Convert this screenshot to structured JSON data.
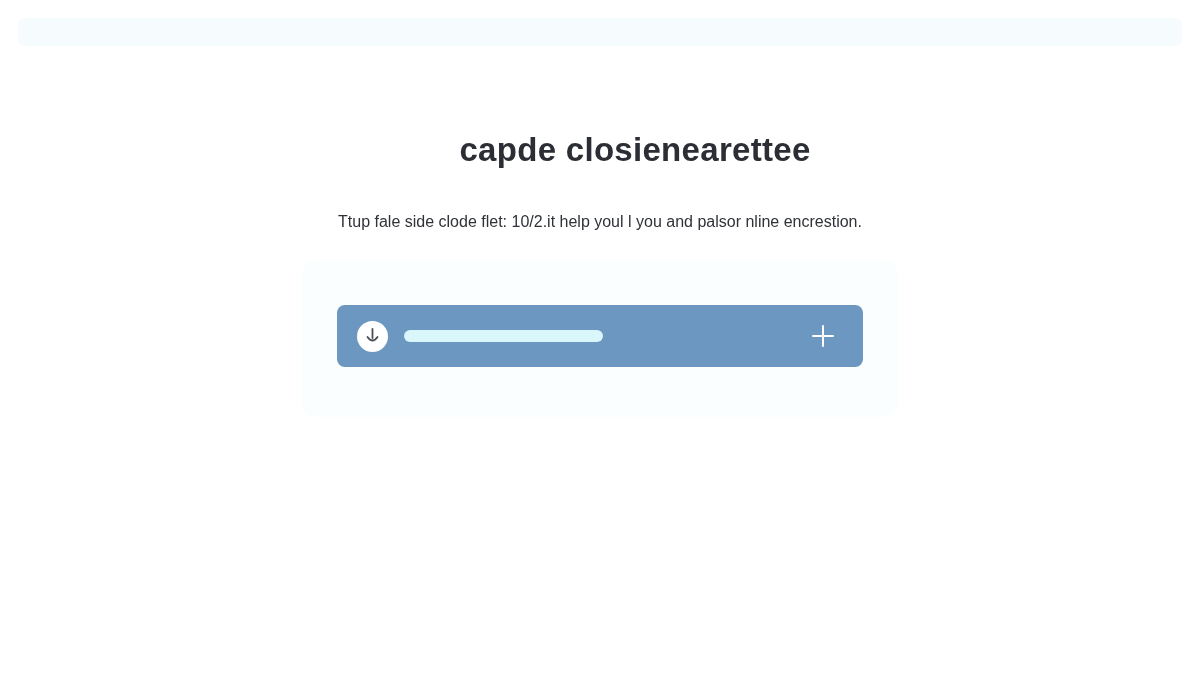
{
  "title": "capde closienearettee",
  "description": "Ttup fale side clode flet: 10/2.it help youl l you and palsor nline encrestion."
}
